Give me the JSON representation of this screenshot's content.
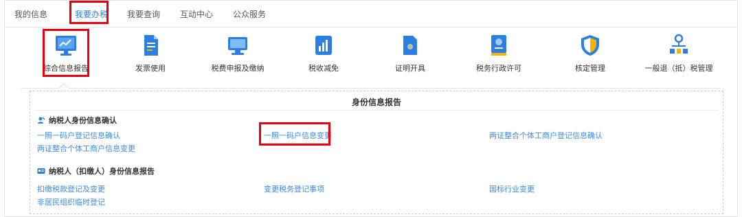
{
  "tabs": [
    {
      "label": "我的信息"
    },
    {
      "label": "我要办税"
    },
    {
      "label": "我要查询"
    },
    {
      "label": "互动中心"
    },
    {
      "label": "公众服务"
    }
  ],
  "menu": [
    {
      "label": "综合信息报告",
      "icon": "monitor-chart-icon"
    },
    {
      "label": "发票使用",
      "icon": "invoice-icon"
    },
    {
      "label": "税费申报及缴纳",
      "icon": "screen-icon"
    },
    {
      "label": "税收减免",
      "icon": "tax-relief-icon"
    },
    {
      "label": "证明开具",
      "icon": "certificate-icon"
    },
    {
      "label": "税务行政许可",
      "icon": "license-icon"
    },
    {
      "label": "核定管理",
      "icon": "shield-icon"
    },
    {
      "label": "一般退（抵）税管理",
      "icon": "org-chart-icon"
    }
  ],
  "panel": {
    "title": "身份信息报告",
    "section1": {
      "title": "纳税人身份信息确认",
      "links": [
        "一照一码户登记信息确认",
        "一照一码户信息变更",
        "两证整合个体工商户登记信息确认",
        "两证整合个体工商户信息变更"
      ]
    },
    "section2": {
      "title": "纳税人（扣缴人）身份信息报告",
      "links": [
        "扣缴税款登记及变更",
        "变更税务登记事项",
        "国标行业变更",
        "非居民组织临时登记"
      ]
    }
  },
  "colors": {
    "accent": "#2c7fe0",
    "link": "#3d8be0",
    "highlight": "#e60012"
  }
}
